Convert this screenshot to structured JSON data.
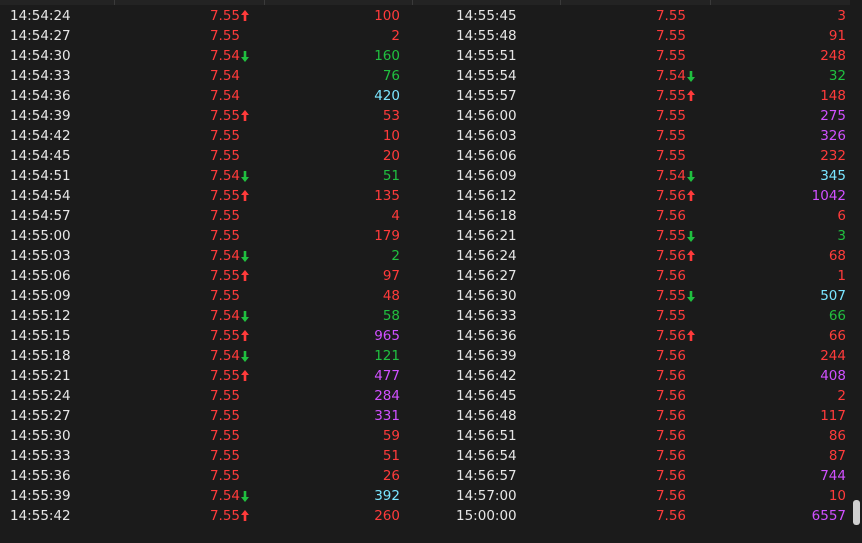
{
  "colors": {
    "time": "#e6e6e6",
    "price": "#ff3b3b",
    "up": "#ff3b3b",
    "down": "#20c040",
    "red": "#ff3b3b",
    "green": "#20c040",
    "cyan": "#7ae5ff",
    "magenta": "#d050ff"
  },
  "columns": [
    {
      "rows": [
        {
          "time": "14:54:24",
          "price": "7.55",
          "dir": "up",
          "volume": "100",
          "vol_color": "red"
        },
        {
          "time": "14:54:27",
          "price": "7.55",
          "dir": "",
          "volume": "2",
          "vol_color": "red"
        },
        {
          "time": "14:54:30",
          "price": "7.54",
          "dir": "down",
          "volume": "160",
          "vol_color": "green"
        },
        {
          "time": "14:54:33",
          "price": "7.54",
          "dir": "",
          "volume": "76",
          "vol_color": "green"
        },
        {
          "time": "14:54:36",
          "price": "7.54",
          "dir": "",
          "volume": "420",
          "vol_color": "cyan"
        },
        {
          "time": "14:54:39",
          "price": "7.55",
          "dir": "up",
          "volume": "53",
          "vol_color": "red"
        },
        {
          "time": "14:54:42",
          "price": "7.55",
          "dir": "",
          "volume": "10",
          "vol_color": "red"
        },
        {
          "time": "14:54:45",
          "price": "7.55",
          "dir": "",
          "volume": "20",
          "vol_color": "red"
        },
        {
          "time": "14:54:51",
          "price": "7.54",
          "dir": "down",
          "volume": "51",
          "vol_color": "green"
        },
        {
          "time": "14:54:54",
          "price": "7.55",
          "dir": "up",
          "volume": "135",
          "vol_color": "red"
        },
        {
          "time": "14:54:57",
          "price": "7.55",
          "dir": "",
          "volume": "4",
          "vol_color": "red"
        },
        {
          "time": "14:55:00",
          "price": "7.55",
          "dir": "",
          "volume": "179",
          "vol_color": "red"
        },
        {
          "time": "14:55:03",
          "price": "7.54",
          "dir": "down",
          "volume": "2",
          "vol_color": "green"
        },
        {
          "time": "14:55:06",
          "price": "7.55",
          "dir": "up",
          "volume": "97",
          "vol_color": "red"
        },
        {
          "time": "14:55:09",
          "price": "7.55",
          "dir": "",
          "volume": "48",
          "vol_color": "red"
        },
        {
          "time": "14:55:12",
          "price": "7.54",
          "dir": "down",
          "volume": "58",
          "vol_color": "green"
        },
        {
          "time": "14:55:15",
          "price": "7.55",
          "dir": "up",
          "volume": "965",
          "vol_color": "magenta"
        },
        {
          "time": "14:55:18",
          "price": "7.54",
          "dir": "down",
          "volume": "121",
          "vol_color": "green"
        },
        {
          "time": "14:55:21",
          "price": "7.55",
          "dir": "up",
          "volume": "477",
          "vol_color": "magenta"
        },
        {
          "time": "14:55:24",
          "price": "7.55",
          "dir": "",
          "volume": "284",
          "vol_color": "magenta"
        },
        {
          "time": "14:55:27",
          "price": "7.55",
          "dir": "",
          "volume": "331",
          "vol_color": "magenta"
        },
        {
          "time": "14:55:30",
          "price": "7.55",
          "dir": "",
          "volume": "59",
          "vol_color": "red"
        },
        {
          "time": "14:55:33",
          "price": "7.55",
          "dir": "",
          "volume": "51",
          "vol_color": "red"
        },
        {
          "time": "14:55:36",
          "price": "7.55",
          "dir": "",
          "volume": "26",
          "vol_color": "red"
        },
        {
          "time": "14:55:39",
          "price": "7.54",
          "dir": "down",
          "volume": "392",
          "vol_color": "cyan"
        },
        {
          "time": "14:55:42",
          "price": "7.55",
          "dir": "up",
          "volume": "260",
          "vol_color": "red"
        }
      ]
    },
    {
      "rows": [
        {
          "time": "14:55:45",
          "price": "7.55",
          "dir": "",
          "volume": "3",
          "vol_color": "red"
        },
        {
          "time": "14:55:48",
          "price": "7.55",
          "dir": "",
          "volume": "91",
          "vol_color": "red"
        },
        {
          "time": "14:55:51",
          "price": "7.55",
          "dir": "",
          "volume": "248",
          "vol_color": "red"
        },
        {
          "time": "14:55:54",
          "price": "7.54",
          "dir": "down",
          "volume": "32",
          "vol_color": "green"
        },
        {
          "time": "14:55:57",
          "price": "7.55",
          "dir": "up",
          "volume": "148",
          "vol_color": "red"
        },
        {
          "time": "14:56:00",
          "price": "7.55",
          "dir": "",
          "volume": "275",
          "vol_color": "magenta"
        },
        {
          "time": "14:56:03",
          "price": "7.55",
          "dir": "",
          "volume": "326",
          "vol_color": "magenta"
        },
        {
          "time": "14:56:06",
          "price": "7.55",
          "dir": "",
          "volume": "232",
          "vol_color": "red"
        },
        {
          "time": "14:56:09",
          "price": "7.54",
          "dir": "down",
          "volume": "345",
          "vol_color": "cyan"
        },
        {
          "time": "14:56:12",
          "price": "7.56",
          "dir": "up",
          "volume": "1042",
          "vol_color": "magenta"
        },
        {
          "time": "14:56:18",
          "price": "7.56",
          "dir": "",
          "volume": "6",
          "vol_color": "red"
        },
        {
          "time": "14:56:21",
          "price": "7.55",
          "dir": "down",
          "volume": "3",
          "vol_color": "green"
        },
        {
          "time": "14:56:24",
          "price": "7.56",
          "dir": "up",
          "volume": "68",
          "vol_color": "red"
        },
        {
          "time": "14:56:27",
          "price": "7.56",
          "dir": "",
          "volume": "1",
          "vol_color": "red"
        },
        {
          "time": "14:56:30",
          "price": "7.55",
          "dir": "down",
          "volume": "507",
          "vol_color": "cyan"
        },
        {
          "time": "14:56:33",
          "price": "7.55",
          "dir": "",
          "volume": "66",
          "vol_color": "green"
        },
        {
          "time": "14:56:36",
          "price": "7.56",
          "dir": "up",
          "volume": "66",
          "vol_color": "red"
        },
        {
          "time": "14:56:39",
          "price": "7.56",
          "dir": "",
          "volume": "244",
          "vol_color": "red"
        },
        {
          "time": "14:56:42",
          "price": "7.56",
          "dir": "",
          "volume": "408",
          "vol_color": "magenta"
        },
        {
          "time": "14:56:45",
          "price": "7.56",
          "dir": "",
          "volume": "2",
          "vol_color": "red"
        },
        {
          "time": "14:56:48",
          "price": "7.56",
          "dir": "",
          "volume": "117",
          "vol_color": "red"
        },
        {
          "time": "14:56:51",
          "price": "7.56",
          "dir": "",
          "volume": "86",
          "vol_color": "red"
        },
        {
          "time": "14:56:54",
          "price": "7.56",
          "dir": "",
          "volume": "87",
          "vol_color": "red"
        },
        {
          "time": "14:56:57",
          "price": "7.56",
          "dir": "",
          "volume": "744",
          "vol_color": "magenta"
        },
        {
          "time": "14:57:00",
          "price": "7.56",
          "dir": "",
          "volume": "10",
          "vol_color": "red"
        },
        {
          "time": "15:00:00",
          "price": "7.56",
          "dir": "",
          "volume": "6557",
          "vol_color": "magenta"
        }
      ]
    }
  ]
}
